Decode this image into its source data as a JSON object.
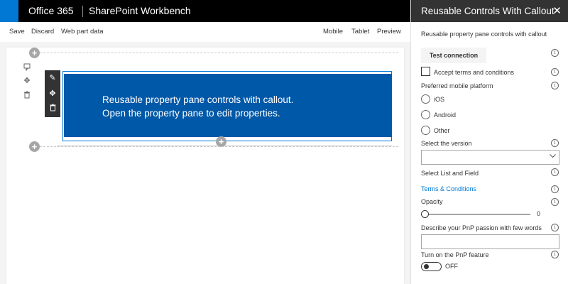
{
  "suite": {
    "brand": "Office 365",
    "app_title": "SharePoint Workbench"
  },
  "commandbar": {
    "left": [
      "Save",
      "Discard",
      "Web part data"
    ],
    "right": [
      "Mobile",
      "Tablet",
      "Preview"
    ]
  },
  "webpart": {
    "line1": "Reusable property pane controls with callout.",
    "line2": "Open the property pane to edit properties."
  },
  "pane": {
    "title": "Reusable Controls With Callout",
    "description": "Reusable property pane controls with callout",
    "test_button": "Test connection",
    "checkbox_label": "Accept terms and conditions",
    "platform_label": "Preferred mobile platform",
    "platform_options": [
      "iOS",
      "Android",
      "Other"
    ],
    "version_label": "Select the version",
    "version_value": "",
    "list_field_label": "Select List and Field",
    "terms_link": "Terms & Conditions",
    "opacity_label": "Opacity",
    "opacity_value": "0",
    "describe_label": "Describe your PnP passion with few words",
    "describe_value": "",
    "feature_label": "Turn on the PnP feature",
    "feature_state": "OFF"
  },
  "icons": {
    "info": "info-icon",
    "close": "close-icon",
    "chevron": "chevron-down-icon",
    "edit": "pencil-icon",
    "move": "move-icon",
    "delete": "trash-icon",
    "add": "add-icon"
  }
}
